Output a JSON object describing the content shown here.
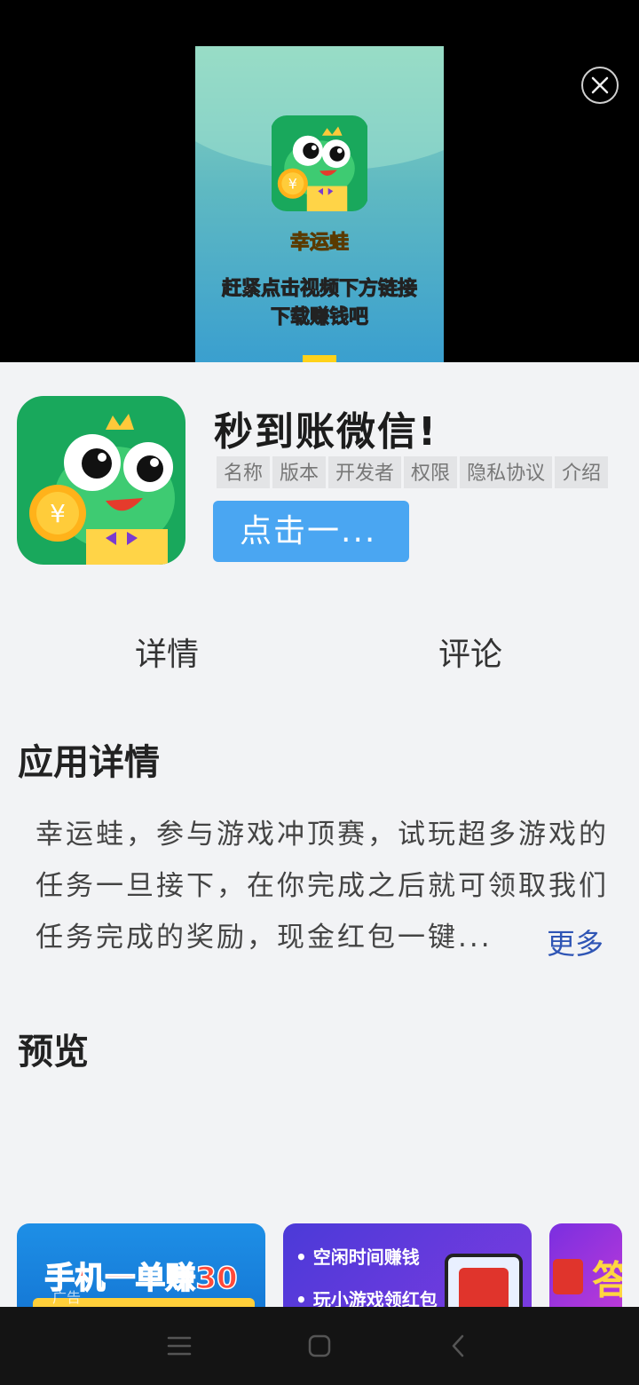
{
  "video": {
    "app_name": "幸运蛙",
    "caption": "赶紧点击视频下方链接\n下载赚钱吧"
  },
  "app": {
    "title": "秒到账微信!",
    "tags": [
      "名称",
      "版本",
      "开发者",
      "权限",
      "隐私协议",
      "介绍"
    ],
    "install_label": "点击一..."
  },
  "tabs": {
    "details": "详情",
    "comments": "评论"
  },
  "details": {
    "title": "应用详情",
    "lines": [
      "幸运蛙，参与游戏冲顶赛，试玩超多游戏的",
      "任务一旦接下，在你完成之后就可领取我们",
      "任务完成的奖励，现金红包一键..."
    ],
    "more_label": "更多"
  },
  "preview": {
    "title": "预览",
    "card1_text": "手机一单赚30",
    "card1_ad": "广告",
    "card2_lines": [
      "• 空闲时间赚钱",
      "• 玩小游戏领红包"
    ],
    "card3_char": "答"
  },
  "colors": {
    "accent": "#4aa6f2",
    "more_link": "#2f55b5",
    "background": "#f2f3f5"
  },
  "icons": {
    "close": "close-icon",
    "nav_menu": "menu-icon",
    "nav_home": "home-icon",
    "nav_back": "back-icon"
  }
}
